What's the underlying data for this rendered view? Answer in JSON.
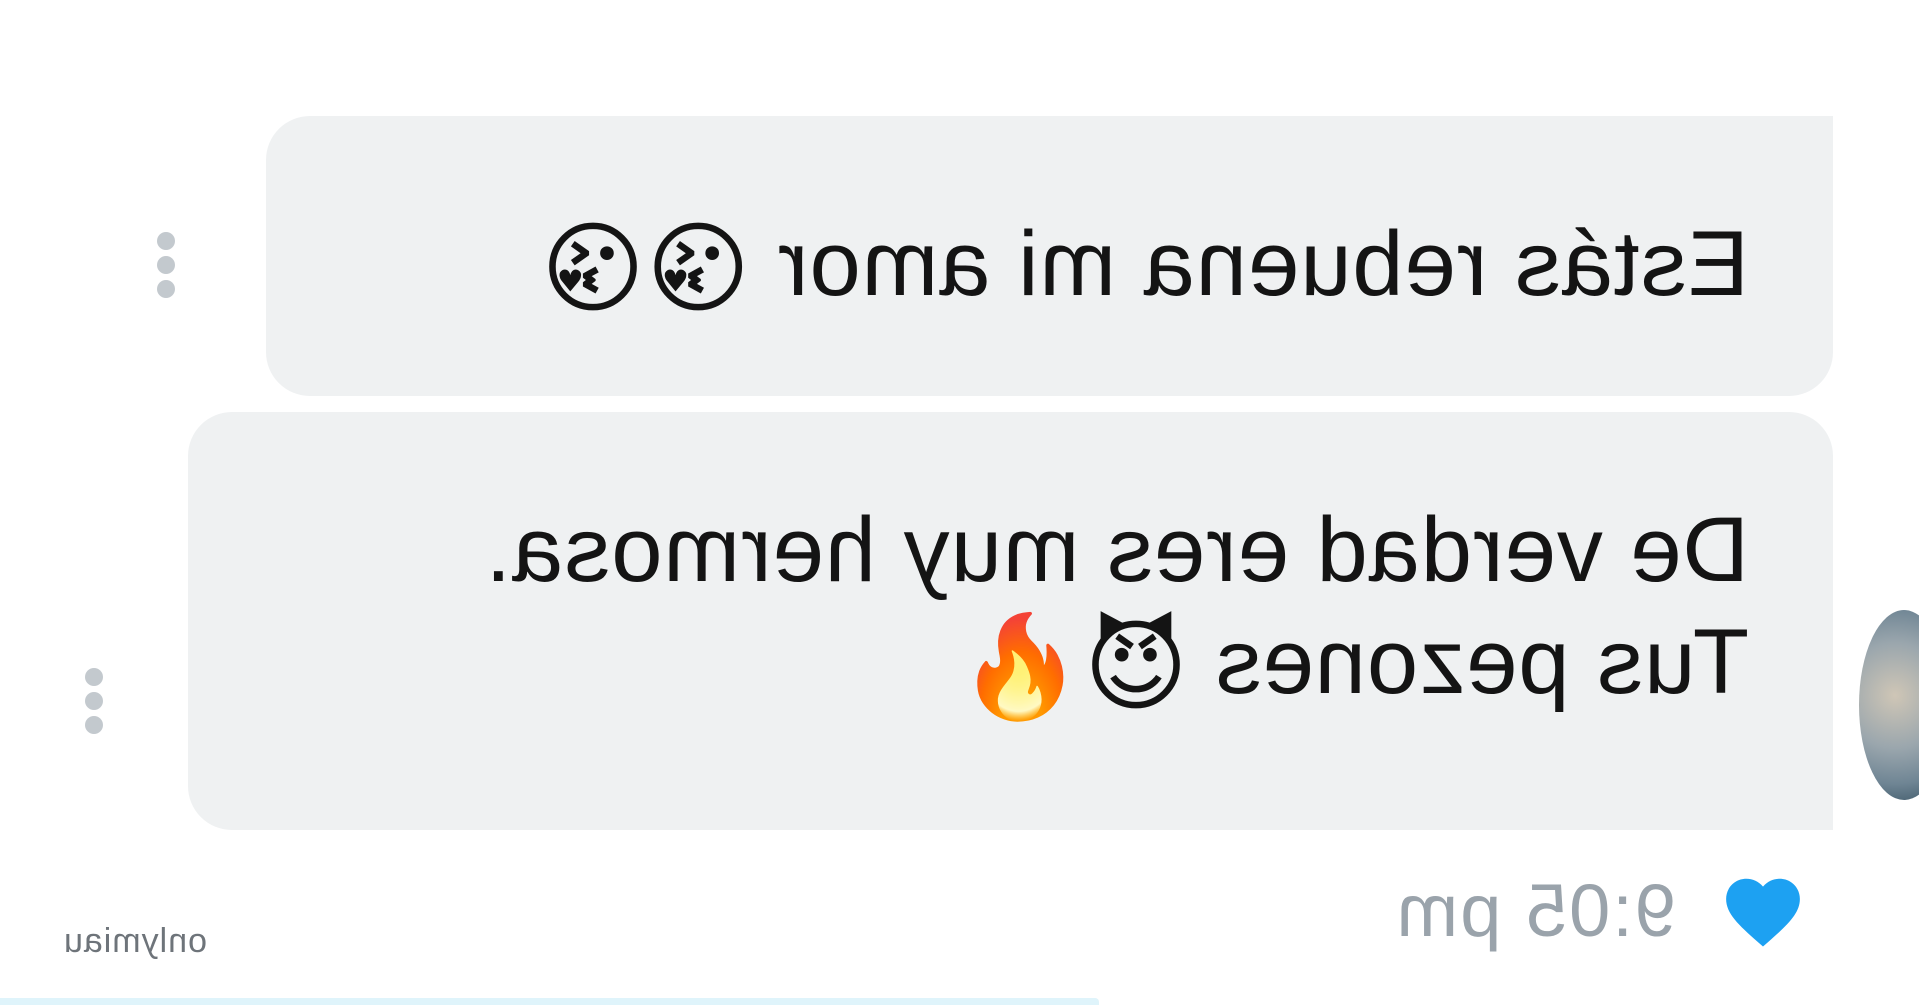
{
  "messages": [
    {
      "text": "Estás rebuena mi amor ",
      "emojis": "😘😘"
    },
    {
      "line1": "De verdad eres muy hermosa.",
      "line2": "Tus pezones ",
      "emojis": "😈🔥"
    }
  ],
  "status": {
    "time": "9:05 pm",
    "reaction_icon": "heart-icon",
    "reaction_color": "#1da1f2"
  },
  "watermark": "onlymiau",
  "colors": {
    "bubble_bg": "#eff1f2",
    "text": "#141414",
    "meta_text": "#9aa3ab",
    "kebab_dots": "#c3c9ce"
  }
}
